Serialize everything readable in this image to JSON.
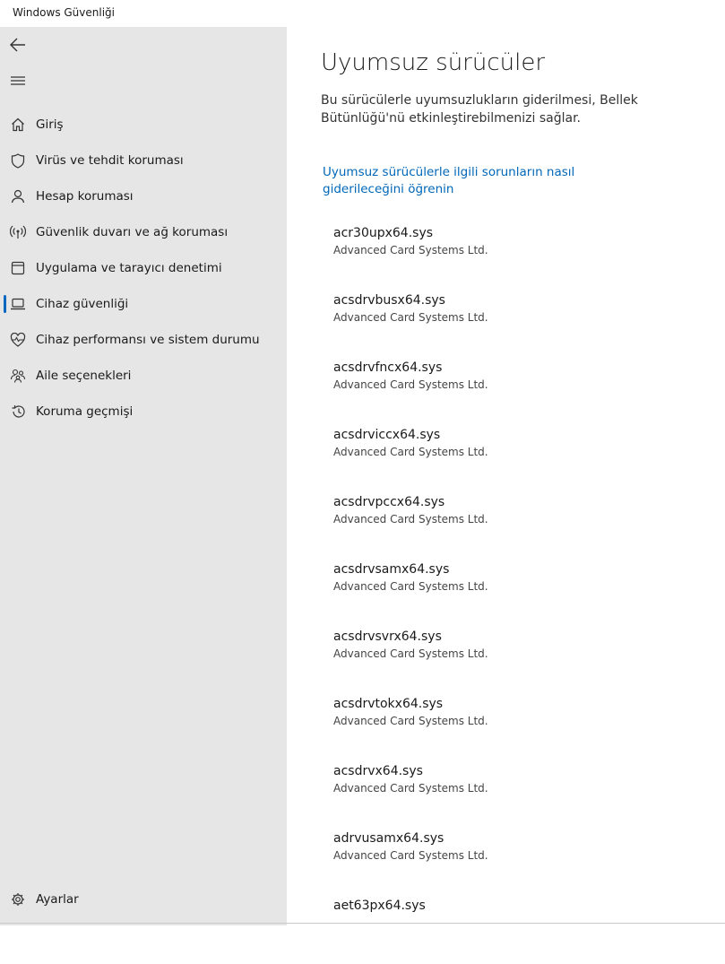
{
  "window": {
    "title": "Windows Güvenliği"
  },
  "sidebar": {
    "items": [
      {
        "label": "Giriş",
        "icon": "home-icon"
      },
      {
        "label": "Virüs ve tehdit koruması",
        "icon": "shield-icon"
      },
      {
        "label": "Hesap koruması",
        "icon": "person-icon"
      },
      {
        "label": "Güvenlik duvarı ve ağ koruması",
        "icon": "network-icon"
      },
      {
        "label": "Uygulama ve tarayıcı denetimi",
        "icon": "browser-icon"
      },
      {
        "label": "Cihaz güvenliği",
        "icon": "laptop-icon",
        "active": true
      },
      {
        "label": "Cihaz performansı ve sistem durumu",
        "icon": "heart-icon"
      },
      {
        "label": "Aile seçenekleri",
        "icon": "family-icon"
      },
      {
        "label": "Koruma geçmişi",
        "icon": "history-icon"
      }
    ],
    "settings_label": "Ayarlar"
  },
  "main": {
    "title": "Uyumsuz sürücüler",
    "description": "Bu sürücülerle uyumsuzlukların giderilmesi, Bellek Bütünlüğü'nü etkinleştirebilmenizi sağlar.",
    "link": "Uyumsuz sürücülerle ilgili sorunların nasıl giderileceğini öğrenin",
    "drivers": [
      {
        "name": "acr30upx64.sys",
        "company": "Advanced Card Systems Ltd."
      },
      {
        "name": "acsdrvbusx64.sys",
        "company": "Advanced Card Systems Ltd."
      },
      {
        "name": "acsdrvfncx64.sys",
        "company": "Advanced Card Systems Ltd."
      },
      {
        "name": "acsdrviccx64.sys",
        "company": "Advanced Card Systems Ltd."
      },
      {
        "name": "acsdrvpccx64.sys",
        "company": "Advanced Card Systems Ltd."
      },
      {
        "name": "acsdrvsamx64.sys",
        "company": "Advanced Card Systems Ltd."
      },
      {
        "name": "acsdrvsvrx64.sys",
        "company": "Advanced Card Systems Ltd."
      },
      {
        "name": "acsdrvtokx64.sys",
        "company": "Advanced Card Systems Ltd."
      },
      {
        "name": "acsdrvx64.sys",
        "company": "Advanced Card Systems Ltd."
      },
      {
        "name": "adrvusamx64.sys",
        "company": "Advanced Card Systems Ltd."
      },
      {
        "name": "aet63px64.sys",
        "company": ""
      }
    ]
  },
  "colors": {
    "accent": "#0067c0",
    "link": "#0067b8",
    "sidebar_bg": "#e6e6e6"
  }
}
